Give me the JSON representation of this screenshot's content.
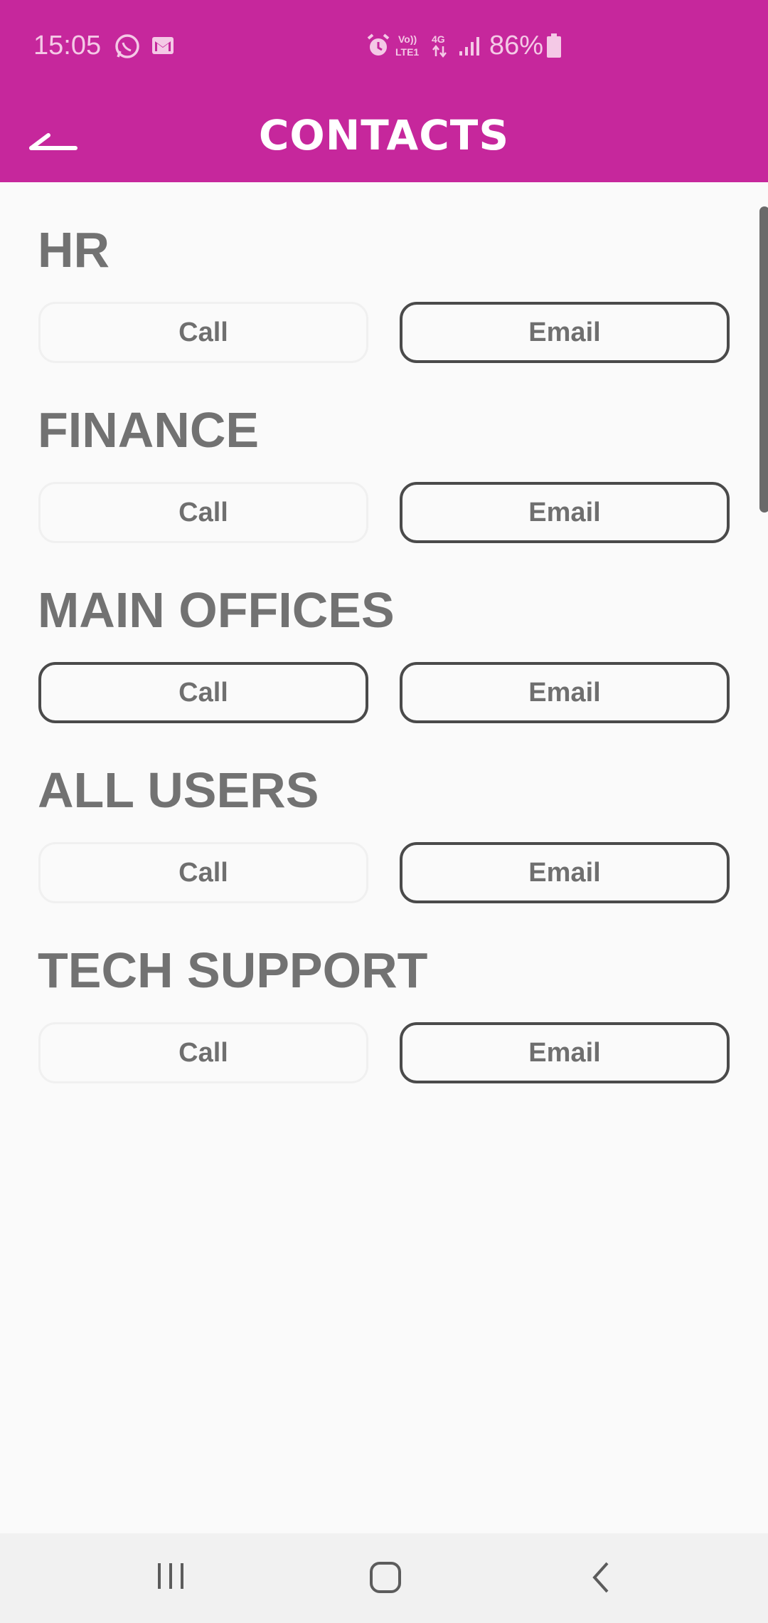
{
  "status_bar": {
    "time": "15:05",
    "battery_percent": "86%",
    "icons": [
      "whatsapp-icon",
      "gmail-icon",
      "alarm-icon",
      "volte-icon",
      "4g-data-icon",
      "signal-icon",
      "battery-icon"
    ],
    "volte_label": "Vo))\nLTE1",
    "network_label": "4G"
  },
  "app_bar": {
    "title": "CONTACTS",
    "background_color": "#c6279c"
  },
  "sections": [
    {
      "title": "HR",
      "call_label": "Call",
      "email_label": "Email"
    },
    {
      "title": "FINANCE",
      "call_label": "Call",
      "email_label": "Email"
    },
    {
      "title": "MAIN OFFICES",
      "call_label": "Call",
      "email_label": "Email"
    },
    {
      "title": "ALL USERS",
      "call_label": "Call",
      "email_label": "Email"
    },
    {
      "title": "TECH SUPPORT",
      "call_label": "Call",
      "email_label": "Email"
    }
  ],
  "nav_bar": {
    "icons": [
      "recent-apps-icon",
      "home-icon",
      "back-nav-icon"
    ]
  }
}
